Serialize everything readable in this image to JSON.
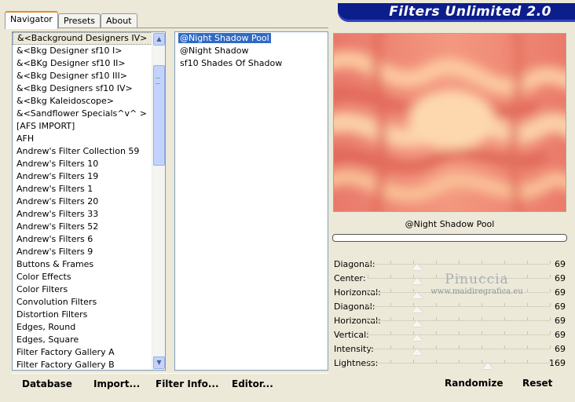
{
  "window": {
    "title": "Filters Unlimited 2.0"
  },
  "tabs": [
    {
      "label": "Navigator"
    },
    {
      "label": "Presets"
    },
    {
      "label": "About"
    }
  ],
  "categories": {
    "selected_index": 0,
    "items": [
      "&<Background Designers IV>",
      "&<Bkg Designer sf10 I>",
      "&<BKg Designer sf10 II>",
      "&<Bkg Designer sf10 III>",
      "&<Bkg Designers sf10 IV>",
      "&<Bkg Kaleidoscope>",
      "&<Sandflower Specials^v^ >",
      "[AFS IMPORT]",
      "AFH",
      "Andrew's Filter Collection 59",
      "Andrew's Filters 10",
      "Andrew's Filters 19",
      "Andrew's Filters 1",
      "Andrew's Filters 20",
      "Andrew's Filters 33",
      "Andrew's Filters 52",
      "Andrew's Filters 6",
      "Andrew's Filters 9",
      "Buttons & Frames",
      "Color Effects",
      "Color Filters",
      "Convolution Filters",
      "Distortion Filters",
      "Edges, Round",
      "Edges, Square",
      "Filter Factory Gallery A",
      "Filter Factory Gallery B"
    ]
  },
  "filters": {
    "selected_index": 0,
    "items": [
      "@Night Shadow Pool",
      "@Night Shadow",
      "sf10 Shades Of Shadow"
    ]
  },
  "preview": {
    "caption": "@Night Shadow Pool",
    "progress": 0,
    "colors": {
      "base": "#f08a78",
      "light": "#fdd2a6",
      "dark": "#e06a5c"
    }
  },
  "sliders": [
    {
      "label": "Diagonal:",
      "value": "69",
      "fraction": 0.27
    },
    {
      "label": "Center:",
      "value": "69",
      "fraction": 0.27
    },
    {
      "label": "Horizontal:",
      "value": "69",
      "fraction": 0.27
    },
    {
      "label": "Diagonal:",
      "value": "69",
      "fraction": 0.27
    },
    {
      "label": "Horizontal:",
      "value": "69",
      "fraction": 0.27
    },
    {
      "label": "Vertical:",
      "value": "69",
      "fraction": 0.27
    },
    {
      "label": "Intensity:",
      "value": "69",
      "fraction": 0.27
    },
    {
      "label": "Lightness:",
      "value": "169",
      "fraction": 0.66
    }
  ],
  "watermark": {
    "name": "Pinuccia",
    "url": "www.maidiregrafica.eu"
  },
  "buttons": {
    "database": "Database",
    "import": "Import...",
    "filter_info": "Filter Info...",
    "editor": "Editor...",
    "randomize": "Randomize",
    "reset": "Reset"
  }
}
